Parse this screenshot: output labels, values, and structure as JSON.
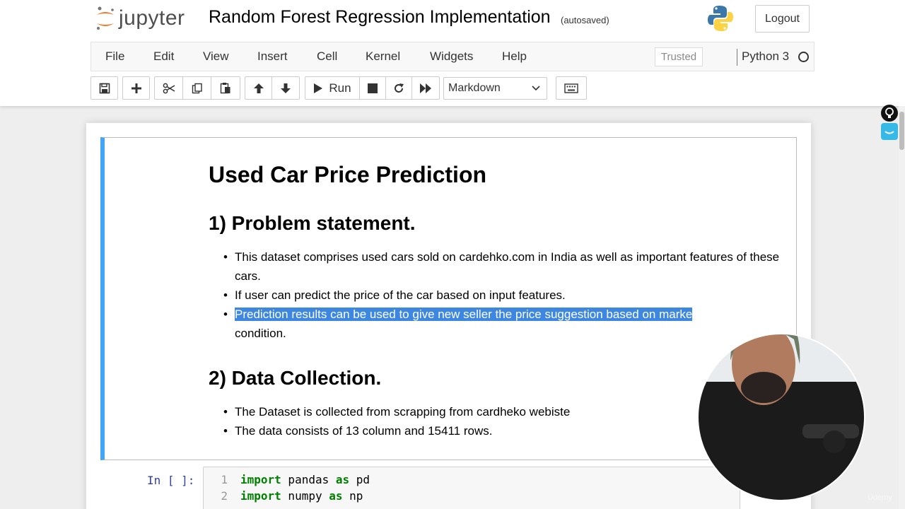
{
  "header": {
    "logo_text": "jupyter",
    "notebook_title": "Random Forest Regression Implementation",
    "autosave_status": "(autosaved)",
    "logout_label": "Logout"
  },
  "menubar": {
    "items": [
      "File",
      "Edit",
      "View",
      "Insert",
      "Cell",
      "Kernel",
      "Widgets",
      "Help"
    ],
    "trusted_label": "Trusted",
    "kernel_name": "Python 3"
  },
  "toolbar": {
    "run_label": "Run",
    "cell_type": "Markdown"
  },
  "markdown_cell": {
    "title": "Used Car Price Prediction",
    "section1_heading": "1) Problem statement.",
    "section1_bullets": [
      "This dataset comprises used cars sold on cardehko.com in India as well as important features of these cars.",
      "If user can predict the price of the car based on input features.",
      "Prediction results can be used to give new seller the price suggestion based on market condition."
    ],
    "section1_bullet3_highlighted": "Prediction results can be used to give new seller the price suggestion based on marke",
    "section1_bullet3_rest": "condition.",
    "section2_heading": "2) Data Collection.",
    "section2_bullets": [
      "The Dataset is collected from scrapping from cardheko webiste",
      "The data consists of 13 column and 15411 rows."
    ]
  },
  "code_cell": {
    "prompt": "In [ ]:",
    "lines": [
      {
        "num": "1",
        "kw1": "import",
        "mod": " pandas ",
        "kw2": "as",
        "alias": " pd"
      },
      {
        "num": "2",
        "kw1": "import",
        "mod": " numpy ",
        "kw2": "as",
        "alias": " np"
      }
    ]
  },
  "watermark": "Udemy",
  "colors": {
    "selected_cell_border": "#42a5f5",
    "highlight": "#3d87e0",
    "keyword": "#008000",
    "prompt": "#303f9f"
  }
}
